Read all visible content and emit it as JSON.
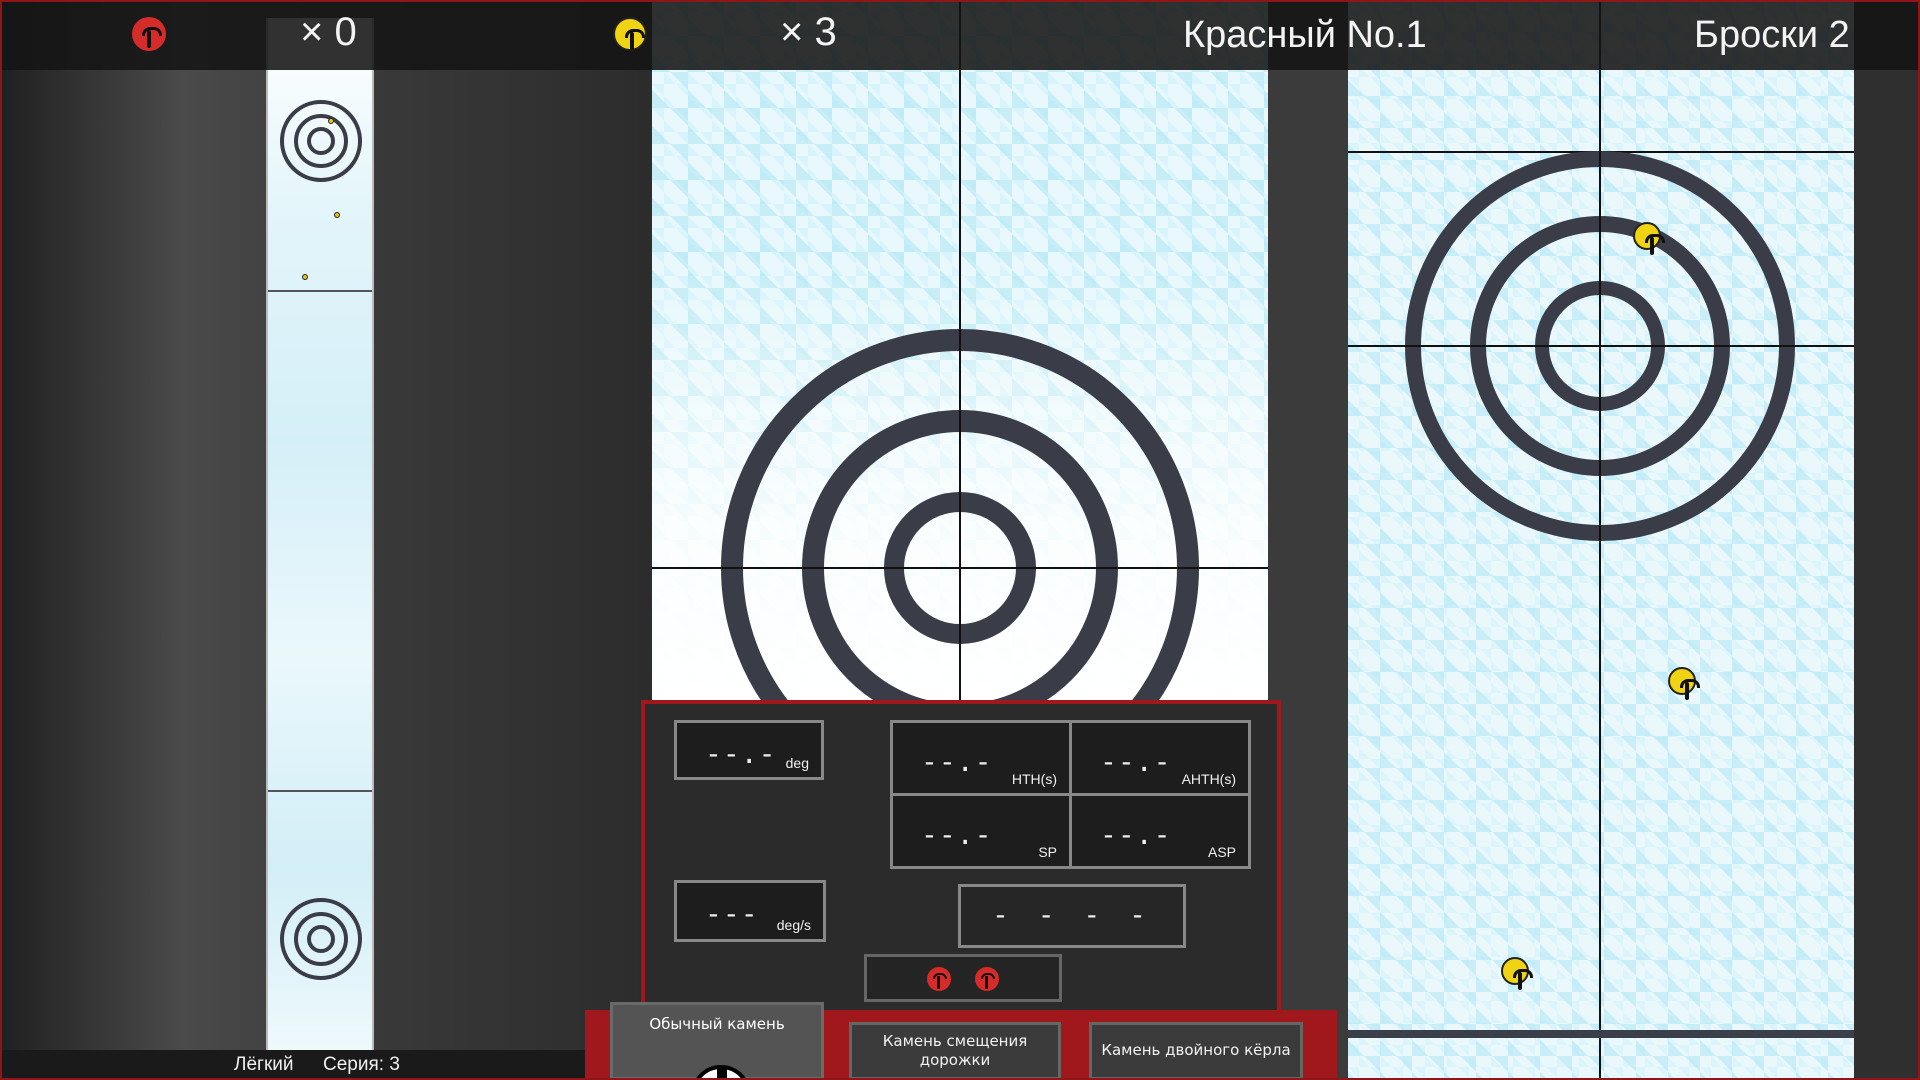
{
  "header": {
    "red_icon": "red-stone-icon",
    "red_count": "× 0",
    "yellow_icon": "yellow-stone-icon",
    "yellow_count": "× 3",
    "team_label": "Красный No.1",
    "throws_label": "Броски 2"
  },
  "panel": {
    "angle": {
      "value": "--.-",
      "unit": "deg"
    },
    "rotation": {
      "value": "---",
      "unit": "deg/s"
    },
    "hth": {
      "value": "--.-",
      "unit": "HTH(s)"
    },
    "ahth": {
      "value": "--.-",
      "unit": "AHTH(s)"
    },
    "sp": {
      "value": "--.-",
      "unit": "SP"
    },
    "asp": {
      "value": "--.-",
      "unit": "ASP"
    },
    "wide": {
      "value": "- - - -"
    },
    "remaining_stones": [
      "red-stone-icon",
      "red-stone-icon"
    ]
  },
  "stone_types": {
    "normal": "Обычный камень",
    "lane_shift": "Камень смещения дорожки",
    "double_curl": "Камень двойного кёрла"
  },
  "status": {
    "difficulty": "Лёгкий",
    "series": "Серия: 3"
  },
  "colors": {
    "red_team": "#d62b2b",
    "yellow_team": "#f0d312",
    "frame": "#a0181c",
    "ring": "#3a3d48"
  }
}
